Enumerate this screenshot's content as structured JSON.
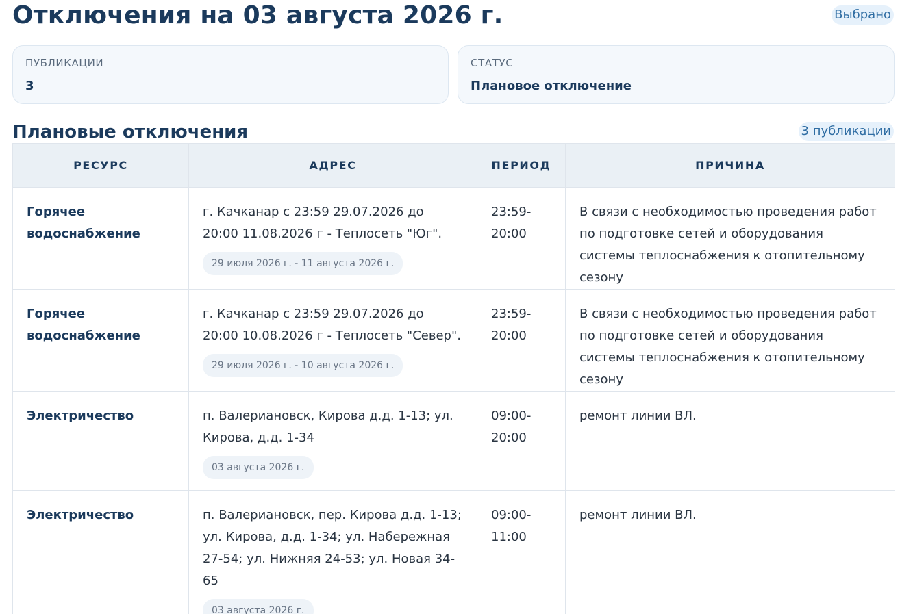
{
  "header": {
    "title": "Отключения на 03 августа 2026 г.",
    "selected_label": "Выбрано"
  },
  "cards": {
    "publications": {
      "label": "ПУБЛИКАЦИИ",
      "value": "3"
    },
    "status": {
      "label": "СТАТУС",
      "value": "Плановое отключение"
    }
  },
  "section": {
    "title": "Плановые отключения",
    "count_label": "3 публикации"
  },
  "table": {
    "headers": [
      "РЕСУРС",
      "АДРЕС",
      "ПЕРИОД",
      "ПРИЧИНА"
    ],
    "rows": [
      {
        "resource": "Горячее водоснабжение",
        "address": "г. Качканар с 23:59 29.07.2026 до 20:00 11.08.2026 г - Теплосеть \"Юг\".",
        "dates": "29 июля 2026 г. - 11 августа 2026 г.",
        "period": "23:59-20:00",
        "reason": "В связи с необходимостью проведения работ по подготовке сетей и оборудования системы теплоснабжения к отопительному сезону"
      },
      {
        "resource": "Горячее водоснабжение",
        "address": "г. Качканар с 23:59 29.07.2026 до 20:00 10.08.2026 г - Теплосеть \"Север\".",
        "dates": "29 июля 2026 г. - 10 августа 2026 г.",
        "period": "23:59-20:00",
        "reason": "В связи с необходимостью проведения работ по подготовке сетей и оборудования системы теплоснабжения к отопительному сезону"
      },
      {
        "resource": "Электричество",
        "address": "п. Валериановск, Кирова д.д. 1-13; ул. Кирова, д.д. 1-34",
        "dates": "03 августа 2026 г.",
        "period": "09:00-20:00",
        "reason": "ремонт линии ВЛ."
      },
      {
        "resource": "Электричество",
        "address": "п. Валериановск, пер. Кирова д.д. 1-13; ул. Кирова, д.д. 1-34; ул. Набережная 27-54; ул. Нижняя 24-53; ул. Новая 34-65",
        "dates": "03 августа 2026 г.",
        "period": "09:00-11:00",
        "reason": "ремонт линии ВЛ."
      }
    ]
  }
}
